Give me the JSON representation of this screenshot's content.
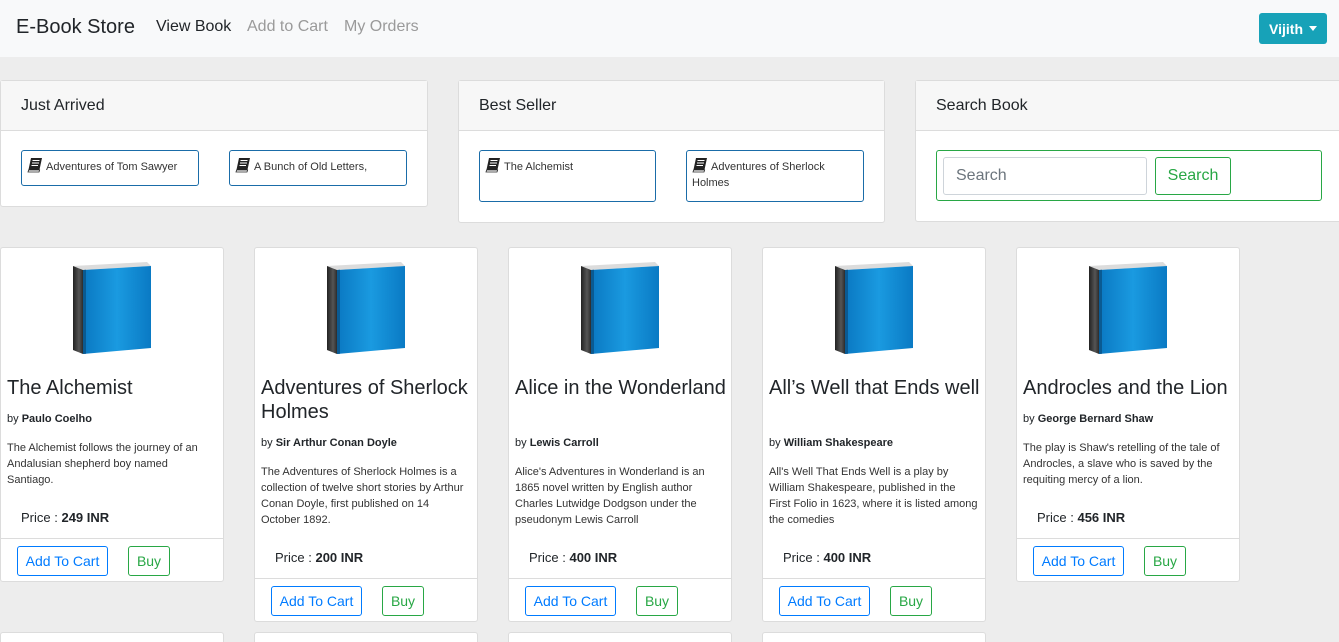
{
  "navbar": {
    "brand": "E-Book Store",
    "links": [
      "View Book",
      "Add to Cart",
      "My Orders"
    ],
    "user": "Vijith"
  },
  "just_arrived": {
    "title": "Just Arrived",
    "items": [
      "Adventures of Tom Sawyer",
      "A Bunch of Old Letters,"
    ]
  },
  "best_seller": {
    "title": "Best Seller",
    "items": [
      "The Alchemist",
      "Adventures of Sherlock Holmes"
    ]
  },
  "search_book": {
    "title": "Search Book",
    "placeholder": "Search",
    "button": "Search"
  },
  "books": [
    {
      "title": "The Alchemist",
      "by": "by",
      "author": "Paulo Coelho",
      "description": "The Alchemist follows the journey of an Andalusian shepherd boy named Santiago.",
      "price_label": "Price : ",
      "price": "249 INR",
      "cart_label": "Add To Cart",
      "buy_label": "Buy"
    },
    {
      "title": "Adventures of Sherlock Holmes",
      "by": "by",
      "author": "Sir Arthur Conan Doyle",
      "description": "The Adventures of Sherlock Holmes is a collection of twelve short stories by Arthur Conan Doyle, first published on 14 October 1892.",
      "price_label": "Price : ",
      "price": "200 INR",
      "cart_label": "Add To Cart",
      "buy_label": "Buy"
    },
    {
      "title": "Alice in the Wonderland",
      "by": "by",
      "author": "Lewis Carroll",
      "description": "Alice's Adventures in Wonderland is an 1865 novel written by English author Charles Lutwidge Dodgson under the pseudonym Lewis Carroll",
      "price_label": "Price : ",
      "price": "400 INR",
      "cart_label": "Add To Cart",
      "buy_label": "Buy"
    },
    {
      "title": "All’s Well that Ends well",
      "by": "by",
      "author": "William Shakespeare",
      "description": "All's Well That Ends Well is a play by William Shakespeare, published in the First Folio in 1623, where it is listed among the comedies",
      "price_label": "Price : ",
      "price": "400 INR",
      "cart_label": "Add To Cart",
      "buy_label": "Buy"
    },
    {
      "title": "Androcles and the Lion",
      "by": "by",
      "author": "George Bernard Shaw",
      "description": "The play is Shaw's retelling of the tale of Androcles, a slave who is saved by the requiting mercy of a lion.",
      "price_label": "Price : ",
      "price": "456 INR",
      "cart_label": "Add To Cart",
      "buy_label": "Buy"
    }
  ],
  "colors": {
    "nav_bg": "#f8f9fa",
    "page_bg": "#ededed",
    "user_btn": "#17a2b8",
    "primary": "#007bff",
    "success": "#28a745",
    "book_blue": "#0b8fd6"
  }
}
